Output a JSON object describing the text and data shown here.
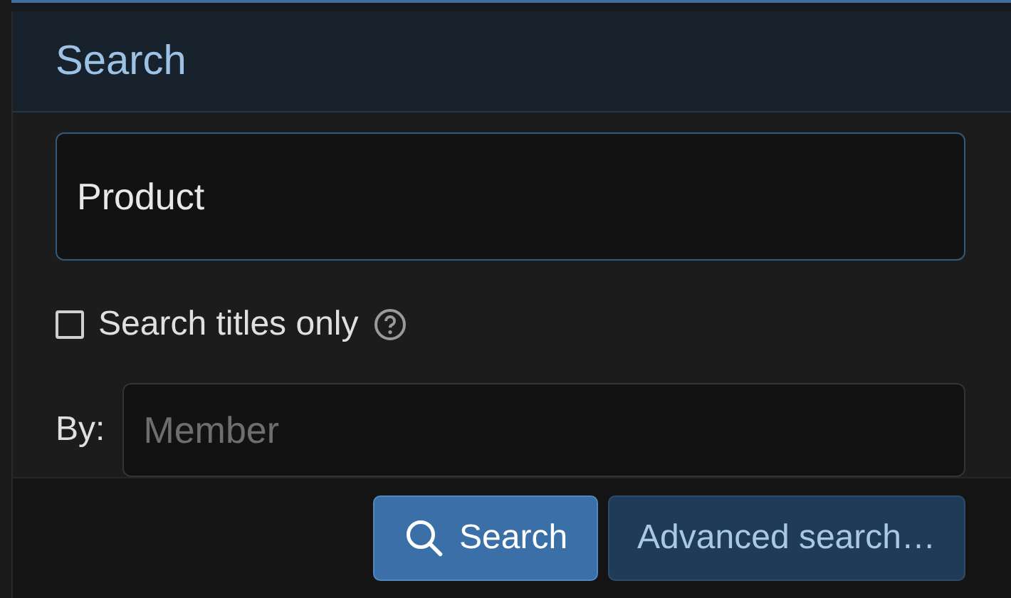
{
  "title": "Search",
  "query": {
    "value": "Product"
  },
  "titles_only": {
    "label": "Search titles only",
    "checked": false
  },
  "by": {
    "label": "By:",
    "placeholder": "Member"
  },
  "buttons": [
    {
      "label": "Search",
      "kind": "primary"
    },
    {
      "label": "Advanced search…",
      "kind": "secondary"
    }
  ]
}
